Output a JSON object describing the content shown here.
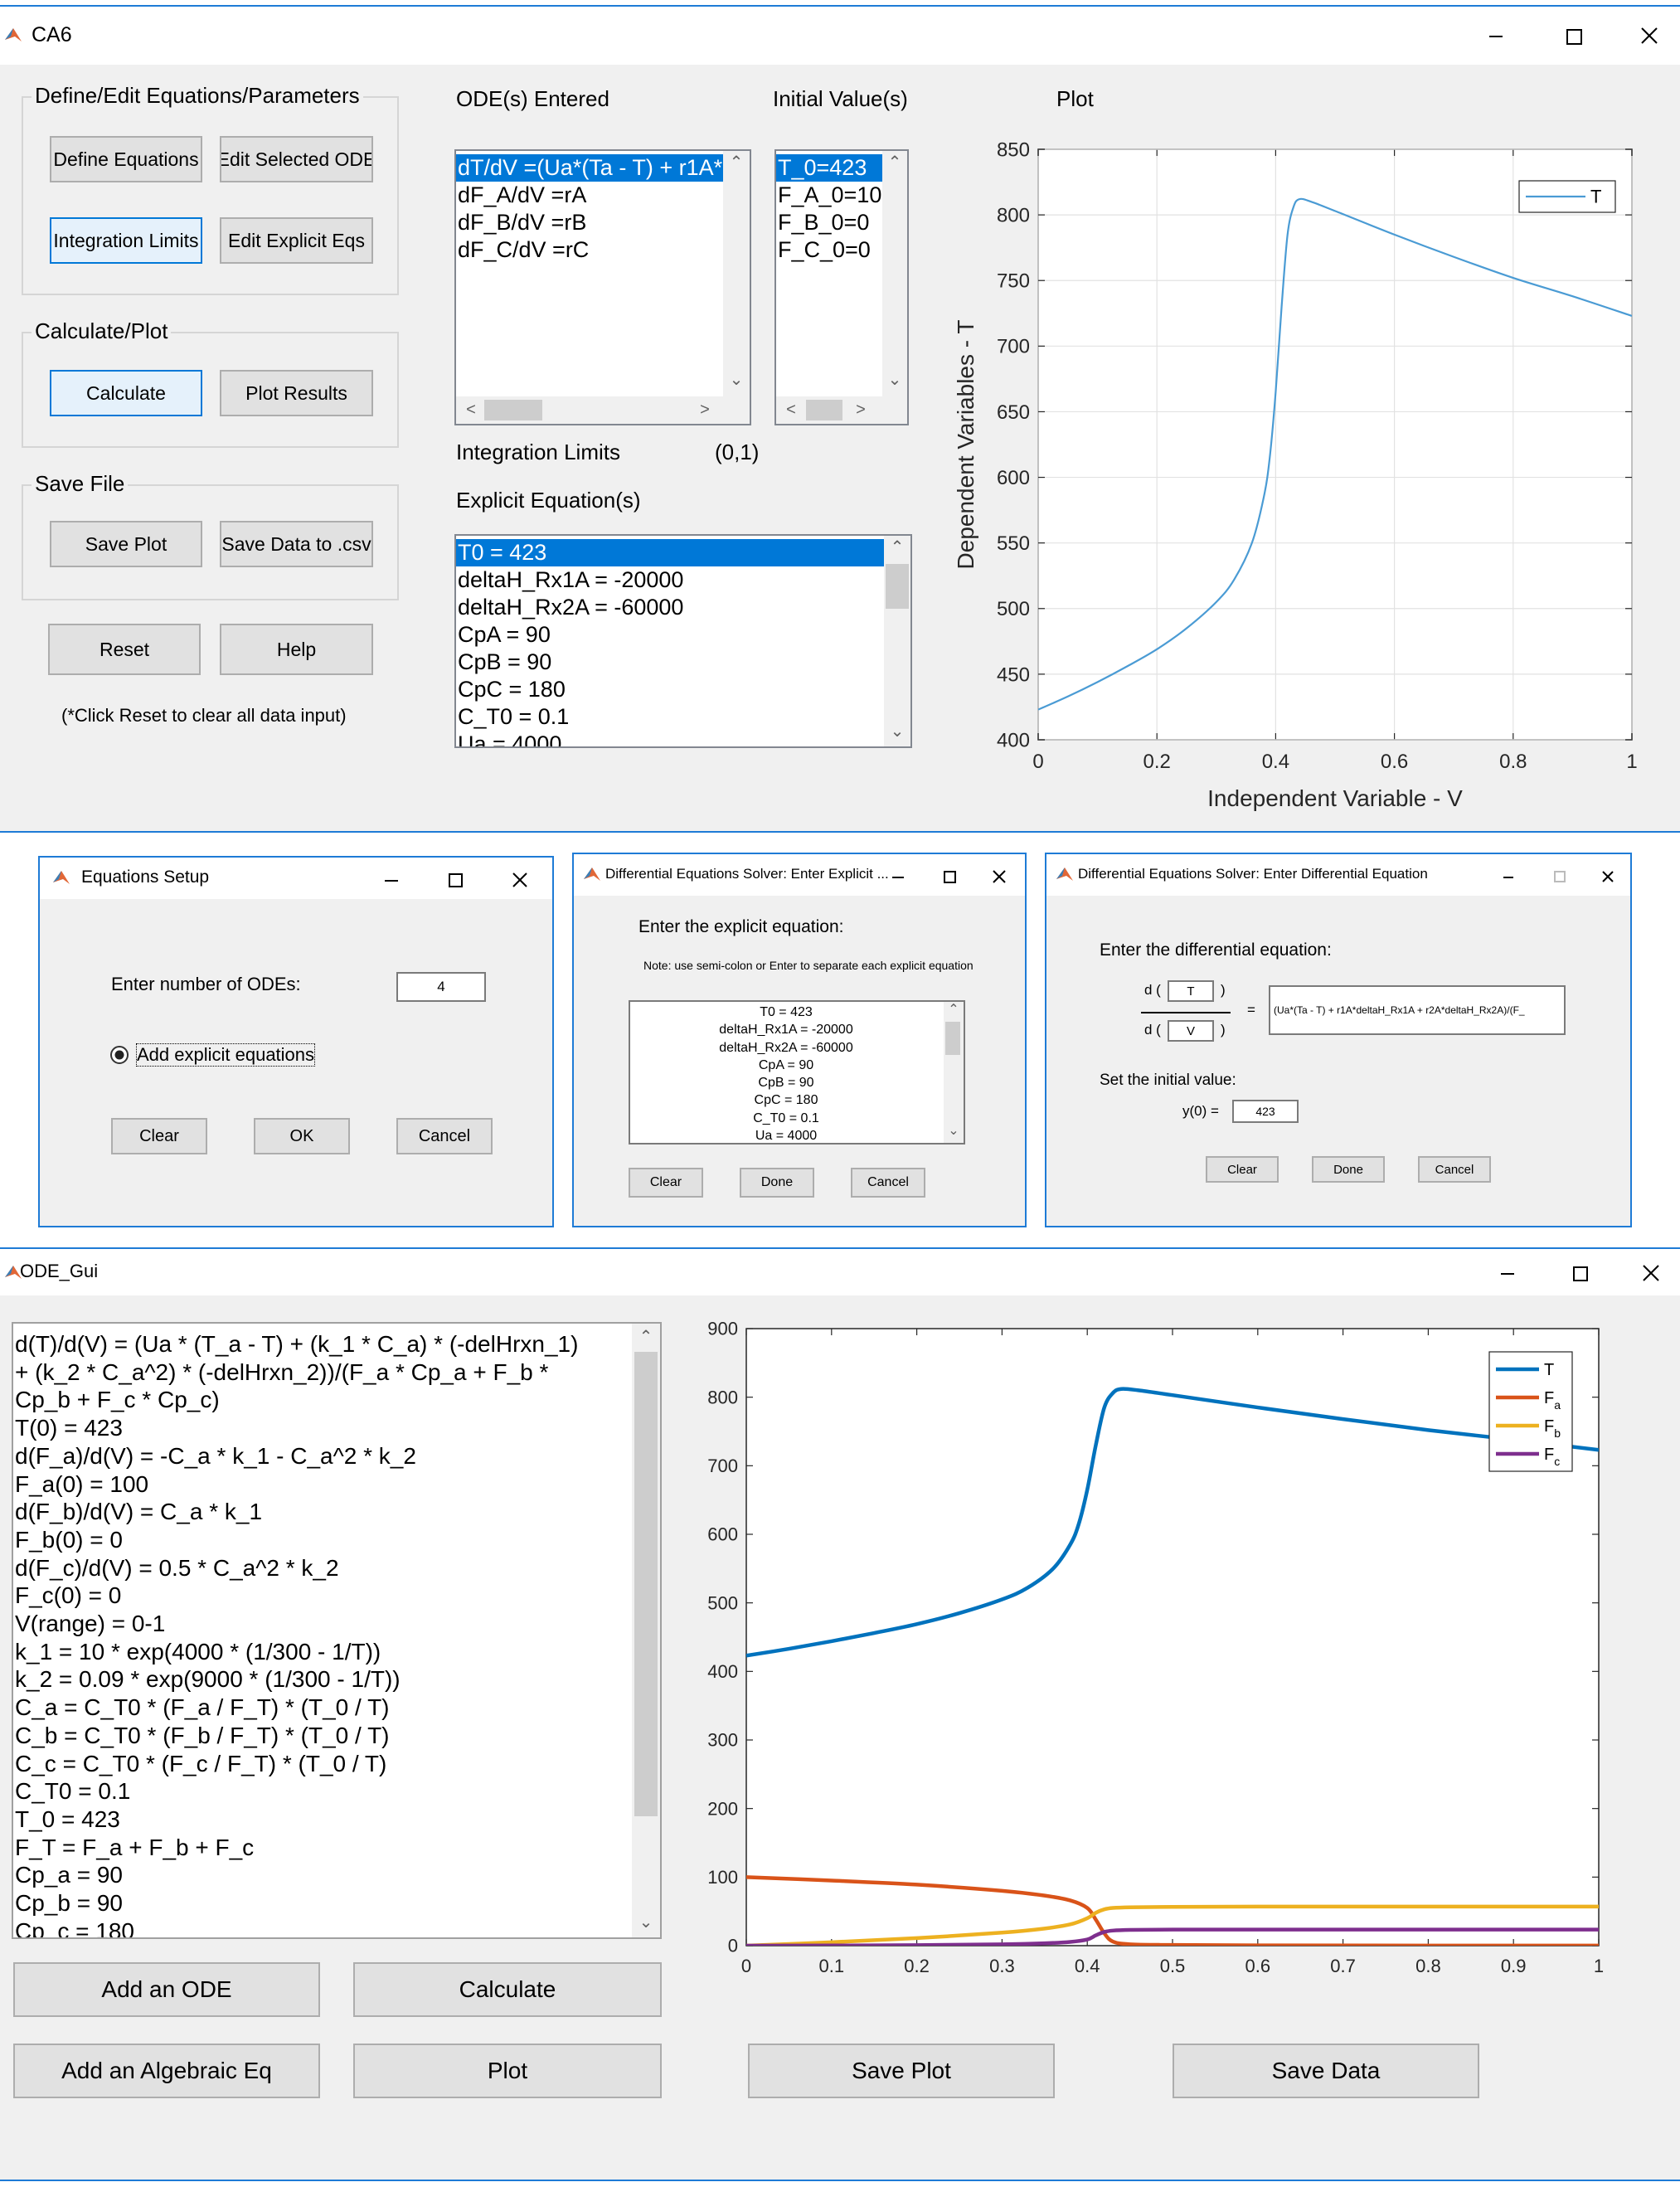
{
  "win1": {
    "title": "CA6",
    "group_define": "Define/Edit Equations/Parameters",
    "btn_define": "Define Equations",
    "btn_edit_ode": "Edit Selected ODE",
    "btn_limits": "Integration Limits",
    "btn_edit_explicit": "Edit Explicit Eqs",
    "group_calc": "Calculate/Plot",
    "btn_calculate": "Calculate",
    "btn_plot": "Plot Results",
    "group_save": "Save File",
    "btn_save_plot": "Save Plot",
    "btn_save_csv": "Save Data to .csv",
    "btn_reset": "Reset",
    "btn_help": "Help",
    "reset_note": "(*Click Reset to clear all data input)",
    "ode_label": "ODE(s) Entered",
    "iv_label": "Initial Value(s)",
    "plot_label": "Plot",
    "odes": [
      "dT/dV =(Ua*(Ta - T) + r1A*",
      "dF_A/dV =rA",
      "dF_B/dV =rB",
      "dF_C/dV =rC"
    ],
    "initial_values": [
      "T_0=423",
      "F_A_0=10",
      "F_B_0=0",
      "F_C_0=0"
    ],
    "limits_label": "Integration Limits",
    "limits_value": "(0,1)",
    "explicit_label": "Explicit Equation(s)",
    "explicit_eqs": [
      "T0 = 423",
      "deltaH_Rx1A = -20000",
      "deltaH_Rx2A = -60000",
      "CpA = 90",
      "CpB = 90",
      "CpC = 180",
      "C_T0 = 0.1",
      "Ua = 4000"
    ]
  },
  "dlg1": {
    "title": "Equations Setup",
    "num_label": "Enter number of ODEs:",
    "num_value": "4",
    "radio_label": "Add explicit equations",
    "btn_clear": "Clear",
    "btn_ok": "OK",
    "btn_cancel": "Cancel"
  },
  "dlg2": {
    "title": "Differential Equations Solver: Enter Explicit ...",
    "prompt": "Enter the explicit equation:",
    "note": "Note: use semi-colon or Enter to separate each explicit equation",
    "lines": [
      "T0 = 423",
      "deltaH_Rx1A = -20000",
      "deltaH_Rx2A = -60000",
      "CpA = 90",
      "CpB = 90",
      "CpC = 180",
      "C_T0 = 0.1",
      "Ua = 4000"
    ],
    "btn_clear": "Clear",
    "btn_done": "Done",
    "btn_cancel": "Cancel"
  },
  "dlg3": {
    "title": "Differential Equations Solver: Enter Differential Equation",
    "prompt": "Enter the differential equation:",
    "d_top": "d (",
    "d_bottom": "d (",
    "close_paren_top": ")",
    "close_paren_bottom": ")",
    "numerator_var": "T",
    "denominator_var": "V",
    "equals": "=",
    "rhs": "(Ua*(Ta - T) + r1A*deltaH_Rx1A + r2A*deltaH_Rx2A)/(F_",
    "iv_prompt": "Set the initial value:",
    "y0_label": "y(0)  =",
    "y0_value": "423",
    "btn_clear": "Clear",
    "btn_done": "Done",
    "btn_cancel": "Cancel"
  },
  "win2": {
    "title": "ODE_Gui",
    "lines": [
      "d(T)/d(V) = (Ua * (T_a - T) + (k_1 * C_a) * (-delHrxn_1)",
      "+ (k_2 * C_a^2) * (-delHrxn_2))/(F_a * Cp_a + F_b *",
      "Cp_b + F_c * Cp_c)",
      "T(0) = 423",
      "d(F_a)/d(V) = -C_a * k_1 - C_a^2 * k_2",
      "F_a(0) = 100",
      "d(F_b)/d(V) = C_a * k_1",
      "F_b(0) = 0",
      "d(F_c)/d(V) = 0.5 * C_a^2 * k_2",
      "F_c(0) = 0",
      "V(range) = 0-1",
      "k_1 = 10 * exp(4000 * (1/300 - 1/T))",
      "k_2 = 0.09 * exp(9000 * (1/300 - 1/T))",
      "C_a = C_T0 * (F_a / F_T) * (T_0 / T)",
      "C_b = C_T0 * (F_b / F_T) * (T_0 / T)",
      "C_c = C_T0 * (F_c / F_T) * (T_0 / T)",
      "C_T0 = 0.1",
      "T_0 = 423",
      "F_T = F_a + F_b + F_c",
      "Cp_a = 90",
      "Cp_b = 90",
      "Cp_c = 180"
    ],
    "btn_add_ode": "Add an ODE",
    "btn_calculate": "Calculate",
    "btn_add_alg": "Add an Algebraic Eq",
    "btn_plot": "Plot",
    "btn_save_plot": "Save Plot",
    "btn_save_data": "Save Data"
  },
  "chart_data": [
    {
      "type": "line",
      "xlabel": "Independent Variable - V",
      "ylabel": "Dependent Variables - T",
      "xlim": [
        0,
        1
      ],
      "ylim": [
        400,
        850
      ],
      "xticks": [
        "0",
        "0.2",
        "0.4",
        "0.6",
        "0.8",
        "1"
      ],
      "yticks": [
        "400",
        "450",
        "500",
        "550",
        "600",
        "650",
        "700",
        "750",
        "800",
        "850"
      ],
      "grid": true,
      "legend": "top-right",
      "series": [
        {
          "name": "T",
          "color": "#4a9bd4",
          "x": [
            0,
            0.05,
            0.1,
            0.15,
            0.2,
            0.25,
            0.3,
            0.33,
            0.36,
            0.38,
            0.39,
            0.4,
            0.41,
            0.42,
            0.43,
            0.44,
            0.46,
            0.5,
            0.6,
            0.7,
            0.8,
            0.9,
            1.0
          ],
          "y": [
            423,
            433,
            444,
            456,
            469,
            485,
            505,
            522,
            550,
            585,
            615,
            665,
            730,
            785,
            806,
            812,
            810,
            803,
            785,
            768,
            752,
            738,
            723
          ]
        }
      ]
    },
    {
      "type": "line",
      "xlim": [
        0,
        1
      ],
      "ylim": [
        0,
        900
      ],
      "xticks": [
        "0",
        "0.1",
        "0.2",
        "0.3",
        "0.4",
        "0.5",
        "0.6",
        "0.7",
        "0.8",
        "0.9",
        "1"
      ],
      "yticks": [
        "0",
        "100",
        "200",
        "300",
        "400",
        "500",
        "600",
        "700",
        "800",
        "900"
      ],
      "grid": false,
      "legend": "top-right",
      "series": [
        {
          "name": "T",
          "color": "#0072bd",
          "x": [
            0,
            0.05,
            0.1,
            0.15,
            0.2,
            0.25,
            0.3,
            0.33,
            0.36,
            0.38,
            0.39,
            0.4,
            0.41,
            0.42,
            0.43,
            0.44,
            0.46,
            0.5,
            0.6,
            0.7,
            0.8,
            0.9,
            1.0
          ],
          "y": [
            423,
            433,
            444,
            456,
            469,
            485,
            505,
            522,
            550,
            585,
            615,
            665,
            730,
            785,
            806,
            812,
            810,
            803,
            785,
            768,
            752,
            738,
            723
          ]
        },
        {
          "name": "F_a",
          "color": "#d95319",
          "x": [
            0,
            0.1,
            0.2,
            0.3,
            0.35,
            0.38,
            0.4,
            0.41,
            0.42,
            0.43,
            0.45,
            0.5,
            0.6,
            0.8,
            1.0
          ],
          "y": [
            100,
            95,
            89,
            80,
            73,
            66,
            55,
            38,
            18,
            6,
            2,
            1,
            0.5,
            0.2,
            0.1
          ]
        },
        {
          "name": "F_b",
          "color": "#edb120",
          "x": [
            0,
            0.1,
            0.2,
            0.3,
            0.35,
            0.38,
            0.4,
            0.41,
            0.42,
            0.43,
            0.45,
            0.5,
            0.6,
            0.8,
            1.0
          ],
          "y": [
            0,
            5,
            11,
            19,
            25,
            31,
            40,
            48,
            53,
            55,
            56,
            56.5,
            57,
            57,
            57
          ]
        },
        {
          "name": "F_c",
          "color": "#7e2f8e",
          "x": [
            0,
            0.1,
            0.2,
            0.3,
            0.35,
            0.38,
            0.4,
            0.41,
            0.42,
            0.43,
            0.45,
            0.5,
            0.6,
            0.8,
            1.0
          ],
          "y": [
            0,
            0.3,
            0.8,
            2,
            3.5,
            5.5,
            9,
            15,
            20,
            22,
            23,
            23.5,
            23.5,
            23.5,
            23.5
          ]
        }
      ]
    }
  ]
}
